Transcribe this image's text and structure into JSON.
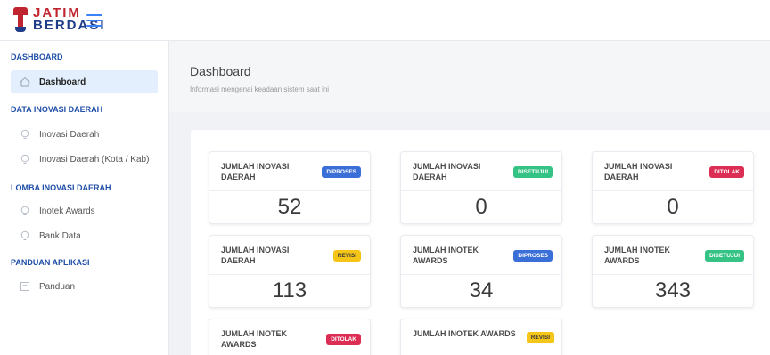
{
  "brand": {
    "line1": "JATIM",
    "line2": "BERDASI"
  },
  "sidebar": {
    "sections": [
      {
        "title": "DASHBOARD",
        "items": [
          {
            "label": "Dashboard",
            "icon": "home-icon",
            "active": true
          }
        ]
      },
      {
        "title": "DATA INOVASI DAERAH",
        "items": [
          {
            "label": "Inovasi Daerah",
            "icon": "bulb-icon"
          },
          {
            "label": "Inovasi Daerah (Kota / Kab)",
            "icon": "bulb-icon"
          }
        ]
      },
      {
        "title": "LOMBA INOVASI DAERAH",
        "items": [
          {
            "label": "Inotek Awards",
            "icon": "bulb-icon"
          },
          {
            "label": "Bank Data",
            "icon": "bulb-icon"
          }
        ]
      },
      {
        "title": "PANDUAN APLIKASI",
        "items": [
          {
            "label": "Panduan",
            "icon": "document-icon"
          }
        ]
      }
    ]
  },
  "header": {
    "title": "Dashboard",
    "subtitle": "Informasi mengenai keadaan sistem saat ini"
  },
  "cards": [
    {
      "label": "JUMLAH INOVASI DAERAH",
      "badge": "DIPROSES",
      "badge_color": "#3b6fd8",
      "value": "52"
    },
    {
      "label": "JUMLAH INOVASI DAERAH",
      "badge": "DISETUJUI",
      "badge_color": "#34c384",
      "value": "0"
    },
    {
      "label": "JUMLAH INOVASI DAERAH",
      "badge": "DITOLAK",
      "badge_color": "#dc2e54",
      "value": "0"
    },
    {
      "label": "JUMLAH INOVASI DAERAH",
      "badge": "REVISI",
      "badge_color": "#f5c518",
      "value": "113"
    },
    {
      "label": "JUMLAH INOTEK AWARDS",
      "badge": "DIPROSES",
      "badge_color": "#3b6fd8",
      "value": "34"
    },
    {
      "label": "JUMLAH INOTEK AWARDS",
      "badge": "DISETUJUI",
      "badge_color": "#34c384",
      "value": "343"
    },
    {
      "label": "JUMLAH INOTEK AWARDS",
      "badge": "DITOLAK",
      "badge_color": "#dc2e54",
      "value": ""
    },
    {
      "label": "JUMLAH INOTEK AWARDS",
      "badge": "REVISI",
      "badge_color": "#f5c518",
      "value": ""
    }
  ]
}
